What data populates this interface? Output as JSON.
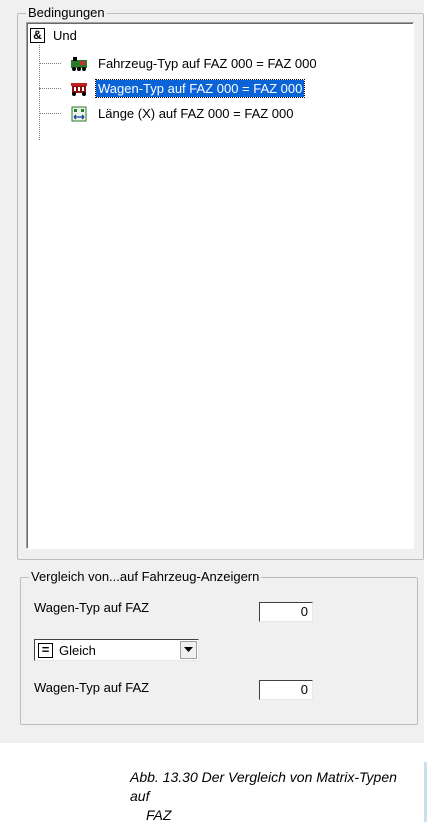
{
  "conditions": {
    "legend": "Bedingungen",
    "root": {
      "icon": "and-operator-icon",
      "symbol": "&",
      "label": "Und"
    },
    "items": [
      {
        "icon": "locomotive-icon",
        "label": "Fahrzeug-Typ auf FAZ 000 = FAZ 000",
        "selected": false
      },
      {
        "icon": "wagon-icon",
        "label": "Wagen-Typ auf FAZ 000 = FAZ 000",
        "selected": true
      },
      {
        "icon": "length-icon",
        "label": "Länge (X) auf FAZ 000 = FAZ 000",
        "selected": false
      }
    ]
  },
  "compare": {
    "legend": "Vergleich von...auf Fahrzeug-Anzeigern",
    "first": {
      "label": "Wagen-Typ auf FAZ",
      "value": "0"
    },
    "operator": {
      "icon": "equals-icon",
      "symbol": "=",
      "value": "Gleich"
    },
    "second": {
      "label": "Wagen-Typ auf FAZ",
      "value": "0"
    }
  },
  "caption": {
    "line1": "Abb. 13.30  Der Vergleich von Matrix-Typen auf",
    "line2": "FAZ"
  },
  "colors": {
    "selection": "#0a64d8",
    "panel": "#f0f0f0"
  }
}
